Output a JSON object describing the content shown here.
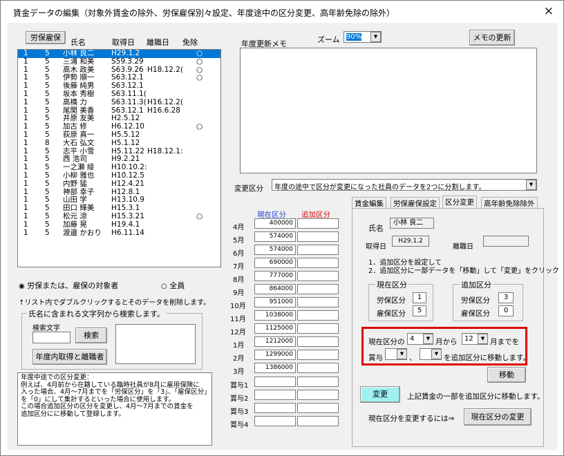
{
  "window": {
    "title": "賃金データの編集（対象外賃金の除外、労保雇保別々設定、年度途中の区分変更、高年齢免除の除外）",
    "close": "✕"
  },
  "list": {
    "header_button": "労保雇保",
    "col_name": "氏名",
    "col_acquired": "取得日",
    "col_left": "離職日",
    "col_exempt": "免除",
    "rows": [
      {
        "a": "1",
        "b": "5",
        "name": "小林 良二",
        "acq": "H29.1.2",
        "left": "",
        "ex": "○",
        "sel": true
      },
      {
        "a": "1",
        "b": "5",
        "name": "三浦 和美",
        "acq": "S59.3.29",
        "left": "",
        "ex": "○"
      },
      {
        "a": "1",
        "b": "5",
        "name": "高木 政美",
        "acq": "S63.9.26",
        "left": "H18.12.2(",
        "ex": "○"
      },
      {
        "a": "1",
        "b": "5",
        "name": "伊勢 順一",
        "acq": "S63.12.1",
        "left": "",
        "ex": "○"
      },
      {
        "a": "1",
        "b": "5",
        "name": "後藤 純男",
        "acq": "S63.12.1",
        "left": "",
        "ex": ""
      },
      {
        "a": "1",
        "b": "5",
        "name": "坂本 秀樹",
        "acq": "S63.11.1(",
        "left": "",
        "ex": ""
      },
      {
        "a": "1",
        "b": "5",
        "name": "高橋 力",
        "acq": "S63.11.3(",
        "left": "H16.12.2(",
        "ex": ""
      },
      {
        "a": "1",
        "b": "5",
        "name": "尾関 美香",
        "acq": "S63.12.1",
        "left": "H16.6.28",
        "ex": ""
      },
      {
        "a": "1",
        "b": "5",
        "name": "井原 友美",
        "acq": "H2.5.12",
        "left": "",
        "ex": ""
      },
      {
        "a": "1",
        "b": "5",
        "name": "加古 修",
        "acq": "H6.12.10",
        "left": "",
        "ex": "○"
      },
      {
        "a": "1",
        "b": "5",
        "name": "荻原 真一",
        "acq": "H5.5.12",
        "left": "",
        "ex": ""
      },
      {
        "a": "1",
        "b": "8",
        "name": "大石 弘文",
        "acq": "H5.1.12",
        "left": "",
        "ex": ""
      },
      {
        "a": "1",
        "b": "5",
        "name": "志平 小雪",
        "acq": "H5.11.22",
        "left": "H18.12.1:",
        "ex": ""
      },
      {
        "a": "1",
        "b": "5",
        "name": "西 浩司",
        "acq": "H9.2.21",
        "left": "",
        "ex": ""
      },
      {
        "a": "1",
        "b": "5",
        "name": "一之瀬 綾",
        "acq": "H10.10.2:",
        "left": "",
        "ex": ""
      },
      {
        "a": "1",
        "b": "5",
        "name": "小柳 雅也",
        "acq": "H10.12.5",
        "left": "",
        "ex": ""
      },
      {
        "a": "1",
        "b": "5",
        "name": "内野 猛",
        "acq": "H12.4.21",
        "left": "",
        "ex": ""
      },
      {
        "a": "1",
        "b": "5",
        "name": "神部 幸子",
        "acq": "H12.8.1",
        "left": "",
        "ex": ""
      },
      {
        "a": "1",
        "b": "5",
        "name": "山田 学",
        "acq": "H13.10.9",
        "left": "",
        "ex": ""
      },
      {
        "a": "1",
        "b": "5",
        "name": "田口 輝美",
        "acq": "H15.3.1",
        "left": "",
        "ex": ""
      },
      {
        "a": "1",
        "b": "5",
        "name": "松元 涼",
        "acq": "H15.3.21",
        "left": "",
        "ex": "○"
      },
      {
        "a": "1",
        "b": "5",
        "name": "加藤 晃",
        "acq": "H19.4.1",
        "left": "",
        "ex": ""
      },
      {
        "a": "1",
        "b": "5",
        "name": "渡邊 かおり",
        "acq": "H6.11.14",
        "left": "",
        "ex": ""
      }
    ]
  },
  "radio": {
    "opt1": "労保または、雇保の対象者",
    "opt2": "全員"
  },
  "hint_delete": "↑リスト内でダブルクリックするとそのデータを削除します。",
  "search": {
    "group_title": "氏名に含まれる文字列から検索します。",
    "label": "検索文字",
    "value": "",
    "button": "検索",
    "btn_year": "年度内取得と離職者",
    "result": ""
  },
  "note": {
    "lines": [
      "年度中途での区分変更：",
      "例えば、4月前から在籍している臨時社員が8月に雇用保険に",
      "入った場合、4月～7月までを「労保区分」を「3」、「雇保区分」",
      "を「0」にして集計するといった場合に使用します。",
      "この場合追加区分の区分を変更し、4月～7月までの賃金を",
      "追加区分にに移動して登録します。"
    ]
  },
  "memo": {
    "label": "年度更新メモ",
    "zoom_label": "ズーム",
    "zoom_value": "90%",
    "update_button": "メモの更新",
    "value": ""
  },
  "kubun": {
    "label": "変更区分",
    "value": "年度の途中で区分が変更になった社員のデータを2つに分割します。"
  },
  "amounts": {
    "head_current": "現在区分",
    "head_added": "追加区分",
    "rows": [
      {
        "m": "4月",
        "v": "400000"
      },
      {
        "m": "5月",
        "v": "574000"
      },
      {
        "m": "6月",
        "v": "574000"
      },
      {
        "m": "7月",
        "v": "690000"
      },
      {
        "m": "8月",
        "v": "777000"
      },
      {
        "m": "9月",
        "v": "864000"
      },
      {
        "m": "10月",
        "v": "951000"
      },
      {
        "m": "11月",
        "v": "1038000"
      },
      {
        "m": "12月",
        "v": "1125000"
      },
      {
        "m": "1月",
        "v": "1212000"
      },
      {
        "m": "2月",
        "v": "1299000"
      },
      {
        "m": "3月",
        "v": "1386000"
      },
      {
        "m": "賞与1",
        "v": ""
      },
      {
        "m": "賞与2",
        "v": ""
      },
      {
        "m": "賞与3",
        "v": ""
      },
      {
        "m": "賞与4",
        "v": ""
      }
    ]
  },
  "tabs": [
    "賃金編集",
    "労保雇保設定",
    "区分変更",
    "高年齢免除除外"
  ],
  "panel": {
    "name_label": "氏名",
    "name_value": "小林 良二",
    "acq_label": "取得日",
    "acq_value": "H29.1.2",
    "left_label": "離職日",
    "left_value": "",
    "step1": "1．追加区分を設定して",
    "step2": "2．追加区分に一部データを「移動」して「変更」をクリック",
    "cur_group": "現在区分",
    "add_group": "追加区分",
    "rousa_label": "労保区分",
    "koyo_label": "雇保区分",
    "cur_rousa": "1",
    "cur_koyo": "5",
    "add_rousa": "3",
    "add_koyo": "0",
    "move_pre": "現在区分の",
    "from_month": "4",
    "from_suffix": "月から",
    "to_month": "12",
    "to_suffix": "月までを",
    "bonus_label": "賞与",
    "bonus1": "",
    "bonus_sep": "、",
    "bonus2": "",
    "bonus_suffix": "を追加区分に移動します。",
    "move_button": "移動",
    "change_button": "変更",
    "change_desc": "上記賃金の一部を追加区分に移動します。",
    "change_cur_desc": "現在区分を変更するには⇒",
    "change_cur_button": "現在区分の変更"
  },
  "colors": {
    "selection": "#0078d7",
    "highlight_border": "#e00000",
    "change_btn": "#9ff0f0"
  }
}
